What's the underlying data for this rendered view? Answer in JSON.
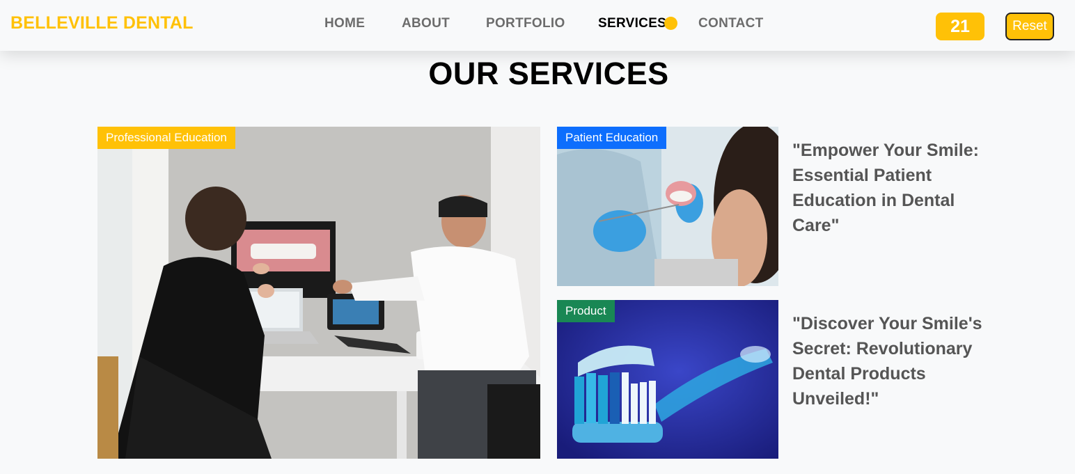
{
  "navbar": {
    "brand": "BELLEVILLE DENTAL",
    "links": [
      "HOME",
      "ABOUT",
      "PORTFOLIO",
      "SERVICES",
      "CONTACT"
    ],
    "active": "SERVICES",
    "counter": "21",
    "reset_label": "Reset"
  },
  "section": {
    "title": "OUR SERVICES"
  },
  "cards": {
    "professional": {
      "badge": "Professional Education",
      "badge_color": "#ffc107"
    },
    "patient": {
      "badge": "Patient Education",
      "badge_color": "#0d6efd",
      "title": "\"Empower Your Smile: Essential Patient Education in Dental Care\""
    },
    "product": {
      "badge": "Product",
      "badge_color": "#198754",
      "title": "\"Discover Your Smile's Secret: Revolutionary Dental Products Unveiled!\""
    }
  },
  "colors": {
    "accent": "#ffc107",
    "background": "#f8f9fa"
  }
}
